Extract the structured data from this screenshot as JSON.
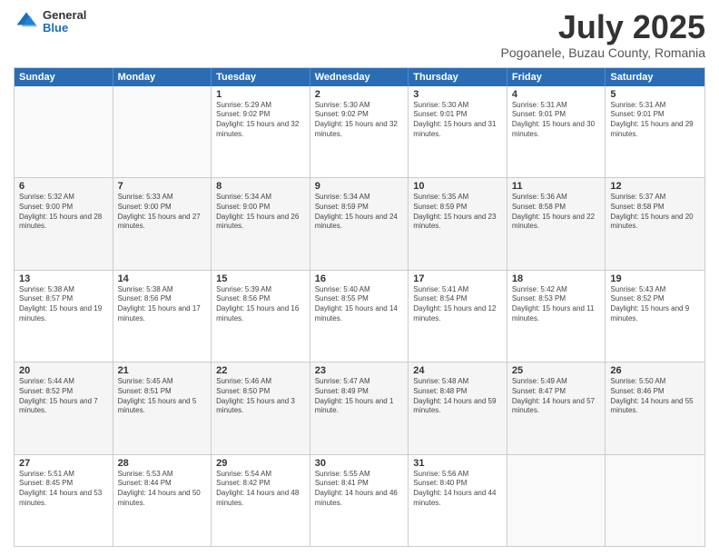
{
  "logo": {
    "general": "General",
    "blue": "Blue"
  },
  "title": "July 2025",
  "subtitle": "Pogoanele, Buzau County, Romania",
  "header_days": [
    "Sunday",
    "Monday",
    "Tuesday",
    "Wednesday",
    "Thursday",
    "Friday",
    "Saturday"
  ],
  "weeks": [
    [
      {
        "day": "",
        "sunrise": "",
        "sunset": "",
        "daylight": "",
        "empty": true
      },
      {
        "day": "",
        "sunrise": "",
        "sunset": "",
        "daylight": "",
        "empty": true
      },
      {
        "day": "1",
        "sunrise": "Sunrise: 5:29 AM",
        "sunset": "Sunset: 9:02 PM",
        "daylight": "Daylight: 15 hours and 32 minutes."
      },
      {
        "day": "2",
        "sunrise": "Sunrise: 5:30 AM",
        "sunset": "Sunset: 9:02 PM",
        "daylight": "Daylight: 15 hours and 32 minutes."
      },
      {
        "day": "3",
        "sunrise": "Sunrise: 5:30 AM",
        "sunset": "Sunset: 9:01 PM",
        "daylight": "Daylight: 15 hours and 31 minutes."
      },
      {
        "day": "4",
        "sunrise": "Sunrise: 5:31 AM",
        "sunset": "Sunset: 9:01 PM",
        "daylight": "Daylight: 15 hours and 30 minutes."
      },
      {
        "day": "5",
        "sunrise": "Sunrise: 5:31 AM",
        "sunset": "Sunset: 9:01 PM",
        "daylight": "Daylight: 15 hours and 29 minutes."
      }
    ],
    [
      {
        "day": "6",
        "sunrise": "Sunrise: 5:32 AM",
        "sunset": "Sunset: 9:00 PM",
        "daylight": "Daylight: 15 hours and 28 minutes."
      },
      {
        "day": "7",
        "sunrise": "Sunrise: 5:33 AM",
        "sunset": "Sunset: 9:00 PM",
        "daylight": "Daylight: 15 hours and 27 minutes."
      },
      {
        "day": "8",
        "sunrise": "Sunrise: 5:34 AM",
        "sunset": "Sunset: 9:00 PM",
        "daylight": "Daylight: 15 hours and 26 minutes."
      },
      {
        "day": "9",
        "sunrise": "Sunrise: 5:34 AM",
        "sunset": "Sunset: 8:59 PM",
        "daylight": "Daylight: 15 hours and 24 minutes."
      },
      {
        "day": "10",
        "sunrise": "Sunrise: 5:35 AM",
        "sunset": "Sunset: 8:59 PM",
        "daylight": "Daylight: 15 hours and 23 minutes."
      },
      {
        "day": "11",
        "sunrise": "Sunrise: 5:36 AM",
        "sunset": "Sunset: 8:58 PM",
        "daylight": "Daylight: 15 hours and 22 minutes."
      },
      {
        "day": "12",
        "sunrise": "Sunrise: 5:37 AM",
        "sunset": "Sunset: 8:58 PM",
        "daylight": "Daylight: 15 hours and 20 minutes."
      }
    ],
    [
      {
        "day": "13",
        "sunrise": "Sunrise: 5:38 AM",
        "sunset": "Sunset: 8:57 PM",
        "daylight": "Daylight: 15 hours and 19 minutes."
      },
      {
        "day": "14",
        "sunrise": "Sunrise: 5:38 AM",
        "sunset": "Sunset: 8:56 PM",
        "daylight": "Daylight: 15 hours and 17 minutes."
      },
      {
        "day": "15",
        "sunrise": "Sunrise: 5:39 AM",
        "sunset": "Sunset: 8:56 PM",
        "daylight": "Daylight: 15 hours and 16 minutes."
      },
      {
        "day": "16",
        "sunrise": "Sunrise: 5:40 AM",
        "sunset": "Sunset: 8:55 PM",
        "daylight": "Daylight: 15 hours and 14 minutes."
      },
      {
        "day": "17",
        "sunrise": "Sunrise: 5:41 AM",
        "sunset": "Sunset: 8:54 PM",
        "daylight": "Daylight: 15 hours and 12 minutes."
      },
      {
        "day": "18",
        "sunrise": "Sunrise: 5:42 AM",
        "sunset": "Sunset: 8:53 PM",
        "daylight": "Daylight: 15 hours and 11 minutes."
      },
      {
        "day": "19",
        "sunrise": "Sunrise: 5:43 AM",
        "sunset": "Sunset: 8:52 PM",
        "daylight": "Daylight: 15 hours and 9 minutes."
      }
    ],
    [
      {
        "day": "20",
        "sunrise": "Sunrise: 5:44 AM",
        "sunset": "Sunset: 8:52 PM",
        "daylight": "Daylight: 15 hours and 7 minutes."
      },
      {
        "day": "21",
        "sunrise": "Sunrise: 5:45 AM",
        "sunset": "Sunset: 8:51 PM",
        "daylight": "Daylight: 15 hours and 5 minutes."
      },
      {
        "day": "22",
        "sunrise": "Sunrise: 5:46 AM",
        "sunset": "Sunset: 8:50 PM",
        "daylight": "Daylight: 15 hours and 3 minutes."
      },
      {
        "day": "23",
        "sunrise": "Sunrise: 5:47 AM",
        "sunset": "Sunset: 8:49 PM",
        "daylight": "Daylight: 15 hours and 1 minute."
      },
      {
        "day": "24",
        "sunrise": "Sunrise: 5:48 AM",
        "sunset": "Sunset: 8:48 PM",
        "daylight": "Daylight: 14 hours and 59 minutes."
      },
      {
        "day": "25",
        "sunrise": "Sunrise: 5:49 AM",
        "sunset": "Sunset: 8:47 PM",
        "daylight": "Daylight: 14 hours and 57 minutes."
      },
      {
        "day": "26",
        "sunrise": "Sunrise: 5:50 AM",
        "sunset": "Sunset: 8:46 PM",
        "daylight": "Daylight: 14 hours and 55 minutes."
      }
    ],
    [
      {
        "day": "27",
        "sunrise": "Sunrise: 5:51 AM",
        "sunset": "Sunset: 8:45 PM",
        "daylight": "Daylight: 14 hours and 53 minutes."
      },
      {
        "day": "28",
        "sunrise": "Sunrise: 5:53 AM",
        "sunset": "Sunset: 8:44 PM",
        "daylight": "Daylight: 14 hours and 50 minutes."
      },
      {
        "day": "29",
        "sunrise": "Sunrise: 5:54 AM",
        "sunset": "Sunset: 8:42 PM",
        "daylight": "Daylight: 14 hours and 48 minutes."
      },
      {
        "day": "30",
        "sunrise": "Sunrise: 5:55 AM",
        "sunset": "Sunset: 8:41 PM",
        "daylight": "Daylight: 14 hours and 46 minutes."
      },
      {
        "day": "31",
        "sunrise": "Sunrise: 5:56 AM",
        "sunset": "Sunset: 8:40 PM",
        "daylight": "Daylight: 14 hours and 44 minutes."
      },
      {
        "day": "",
        "sunrise": "",
        "sunset": "",
        "daylight": "",
        "empty": true
      },
      {
        "day": "",
        "sunrise": "",
        "sunset": "",
        "daylight": "",
        "empty": true
      }
    ]
  ]
}
